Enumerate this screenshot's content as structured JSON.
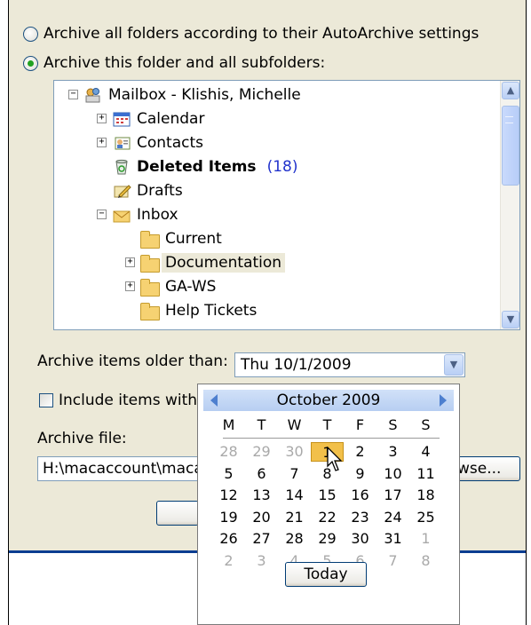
{
  "options": {
    "archive_all_label": "Archive all folders according to their AutoArchive settings",
    "archive_this_label": "Archive this folder and all subfolders:",
    "selected": "archive_this"
  },
  "folders": {
    "root": "Mailbox - Klishis, Michelle",
    "calendar": "Calendar",
    "contacts": "Contacts",
    "deleted": "Deleted Items",
    "deleted_count": "(18)",
    "drafts": "Drafts",
    "inbox": "Inbox",
    "current": "Current",
    "documentation": "Documentation",
    "gaws": "GA-WS",
    "help": "Help Tickets"
  },
  "older_than": {
    "label": "Archive items older than:",
    "value": "Thu 10/1/2009"
  },
  "include": {
    "label": "Include items with",
    "checked": false
  },
  "archive_file": {
    "label": "Archive file:",
    "value": "H:\\macaccount\\maca",
    "browse_label": "wse..."
  },
  "calendar": {
    "month_label": "October 2009",
    "dow": [
      "M",
      "T",
      "W",
      "T",
      "F",
      "S",
      "S"
    ],
    "weeks": [
      [
        {
          "d": "28",
          "o": true
        },
        {
          "d": "29",
          "o": true
        },
        {
          "d": "30",
          "o": true
        },
        {
          "d": "1",
          "s": true
        },
        {
          "d": "2"
        },
        {
          "d": "3"
        },
        {
          "d": "4"
        }
      ],
      [
        {
          "d": "5"
        },
        {
          "d": "6"
        },
        {
          "d": "7"
        },
        {
          "d": "8"
        },
        {
          "d": "9"
        },
        {
          "d": "10"
        },
        {
          "d": "11"
        }
      ],
      [
        {
          "d": "12"
        },
        {
          "d": "13"
        },
        {
          "d": "14"
        },
        {
          "d": "15"
        },
        {
          "d": "16"
        },
        {
          "d": "17"
        },
        {
          "d": "18"
        }
      ],
      [
        {
          "d": "19"
        },
        {
          "d": "20"
        },
        {
          "d": "21"
        },
        {
          "d": "22"
        },
        {
          "d": "23"
        },
        {
          "d": "24"
        },
        {
          "d": "25"
        }
      ],
      [
        {
          "d": "26"
        },
        {
          "d": "27"
        },
        {
          "d": "28"
        },
        {
          "d": "29"
        },
        {
          "d": "30"
        },
        {
          "d": "31"
        },
        {
          "d": "1",
          "o": true
        }
      ],
      [
        {
          "d": "2",
          "o": true
        },
        {
          "d": "3",
          "o": true
        },
        {
          "d": "4",
          "o": true
        },
        {
          "d": "5",
          "o": true
        },
        {
          "d": "6",
          "o": true
        },
        {
          "d": "7",
          "o": true
        },
        {
          "d": "8",
          "o": true
        }
      ]
    ],
    "today_label": "Today",
    "selected_color": "#f2c04a",
    "header_color": "#b7cef2"
  },
  "colors": {
    "dialog_bg": "#ece9d8",
    "accent_blue": "#0b3d91",
    "count_blue": "#2233cc"
  }
}
